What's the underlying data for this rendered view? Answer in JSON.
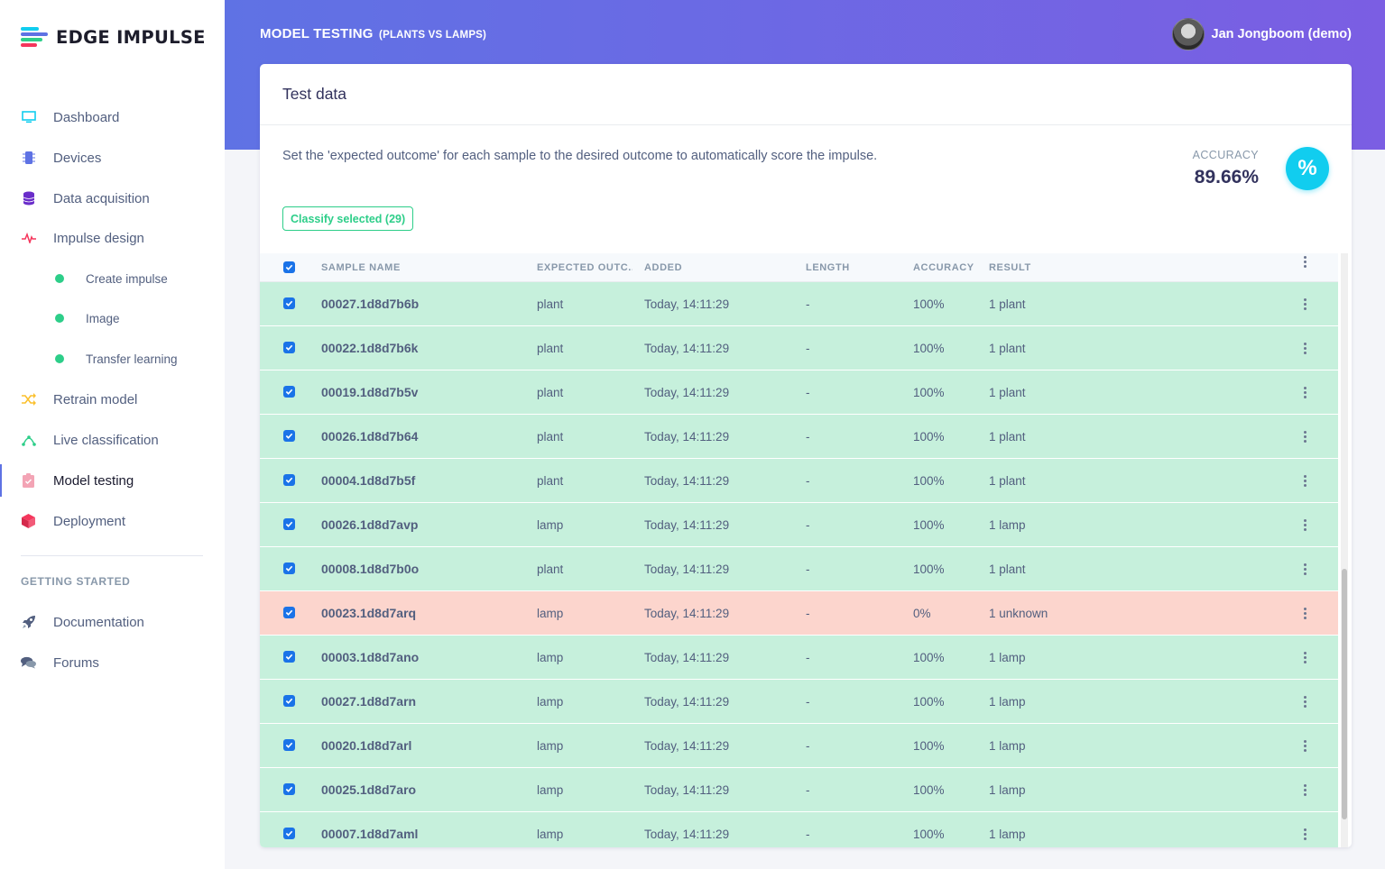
{
  "brand": {
    "name": "EDGE IMPULSE"
  },
  "sidebar": {
    "items": [
      {
        "label": "Dashboard",
        "icon": "monitor-icon",
        "color": "#11cdef"
      },
      {
        "label": "Devices",
        "icon": "chip-icon",
        "color": "#5e72e4"
      },
      {
        "label": "Data acquisition",
        "icon": "database-icon",
        "color": "#6a2dca"
      },
      {
        "label": "Impulse design",
        "icon": "pulse-icon",
        "color": "#f5365c"
      },
      {
        "label": "Retrain model",
        "icon": "shuffle-icon",
        "color": "#fbc02d"
      },
      {
        "label": "Live classification",
        "icon": "bezier-icon",
        "color": "#2dce89"
      },
      {
        "label": "Model testing",
        "icon": "clipboard-check-icon",
        "color": "#f3a4b5"
      },
      {
        "label": "Deployment",
        "icon": "cube-icon",
        "color": "#f5365c"
      }
    ],
    "sub_items": [
      {
        "label": "Create impulse"
      },
      {
        "label": "Image"
      },
      {
        "label": "Transfer learning"
      }
    ],
    "getting_started": {
      "heading": "GETTING STARTED",
      "items": [
        {
          "label": "Documentation",
          "icon": "rocket-icon"
        },
        {
          "label": "Forums",
          "icon": "chat-icon"
        }
      ]
    }
  },
  "header": {
    "title": "MODEL TESTING",
    "subtitle": "(PLANTS VS LAMPS)",
    "user": "Jan Jongboom (demo)"
  },
  "card": {
    "title": "Test data",
    "description": "Set the 'expected outcome' for each sample to the desired outcome to automatically score the impulse.",
    "accuracy_label": "ACCURACY",
    "accuracy_value": "89.66%",
    "accuracy_icon": "%",
    "classify_button": "Classify selected (29)"
  },
  "table": {
    "columns": [
      "SAMPLE NAME",
      "EXPECTED OUTC...",
      "ADDED",
      "LENGTH",
      "ACCURACY",
      "RESULT"
    ],
    "rows": [
      {
        "name": "00027.1d8d7b6b",
        "expected": "plant",
        "added": "Today, 14:11:29",
        "length": "-",
        "accuracy": "100%",
        "result": "1 plant",
        "status": "ok"
      },
      {
        "name": "00022.1d8d7b6k",
        "expected": "plant",
        "added": "Today, 14:11:29",
        "length": "-",
        "accuracy": "100%",
        "result": "1 plant",
        "status": "ok"
      },
      {
        "name": "00019.1d8d7b5v",
        "expected": "plant",
        "added": "Today, 14:11:29",
        "length": "-",
        "accuracy": "100%",
        "result": "1 plant",
        "status": "ok"
      },
      {
        "name": "00026.1d8d7b64",
        "expected": "plant",
        "added": "Today, 14:11:29",
        "length": "-",
        "accuracy": "100%",
        "result": "1 plant",
        "status": "ok"
      },
      {
        "name": "00004.1d8d7b5f",
        "expected": "plant",
        "added": "Today, 14:11:29",
        "length": "-",
        "accuracy": "100%",
        "result": "1 plant",
        "status": "ok"
      },
      {
        "name": "00026.1d8d7avp",
        "expected": "lamp",
        "added": "Today, 14:11:29",
        "length": "-",
        "accuracy": "100%",
        "result": "1 lamp",
        "status": "ok"
      },
      {
        "name": "00008.1d8d7b0o",
        "expected": "plant",
        "added": "Today, 14:11:29",
        "length": "-",
        "accuracy": "100%",
        "result": "1 plant",
        "status": "ok"
      },
      {
        "name": "00023.1d8d7arq",
        "expected": "lamp",
        "added": "Today, 14:11:29",
        "length": "-",
        "accuracy": "0%",
        "result": "1 unknown",
        "status": "bad"
      },
      {
        "name": "00003.1d8d7ano",
        "expected": "lamp",
        "added": "Today, 14:11:29",
        "length": "-",
        "accuracy": "100%",
        "result": "1 lamp",
        "status": "ok"
      },
      {
        "name": "00027.1d8d7arn",
        "expected": "lamp",
        "added": "Today, 14:11:29",
        "length": "-",
        "accuracy": "100%",
        "result": "1 lamp",
        "status": "ok"
      },
      {
        "name": "00020.1d8d7arl",
        "expected": "lamp",
        "added": "Today, 14:11:29",
        "length": "-",
        "accuracy": "100%",
        "result": "1 lamp",
        "status": "ok"
      },
      {
        "name": "00025.1d8d7aro",
        "expected": "lamp",
        "added": "Today, 14:11:29",
        "length": "-",
        "accuracy": "100%",
        "result": "1 lamp",
        "status": "ok"
      },
      {
        "name": "00007.1d8d7aml",
        "expected": "lamp",
        "added": "Today, 14:11:29",
        "length": "-",
        "accuracy": "100%",
        "result": "1 lamp",
        "status": "ok"
      }
    ]
  },
  "colors": {
    "ok_row": "#c6f0dc",
    "bad_row": "#fcd5cd",
    "accent": "#5e72e4",
    "success": "#2dce89",
    "info": "#11cdef"
  }
}
